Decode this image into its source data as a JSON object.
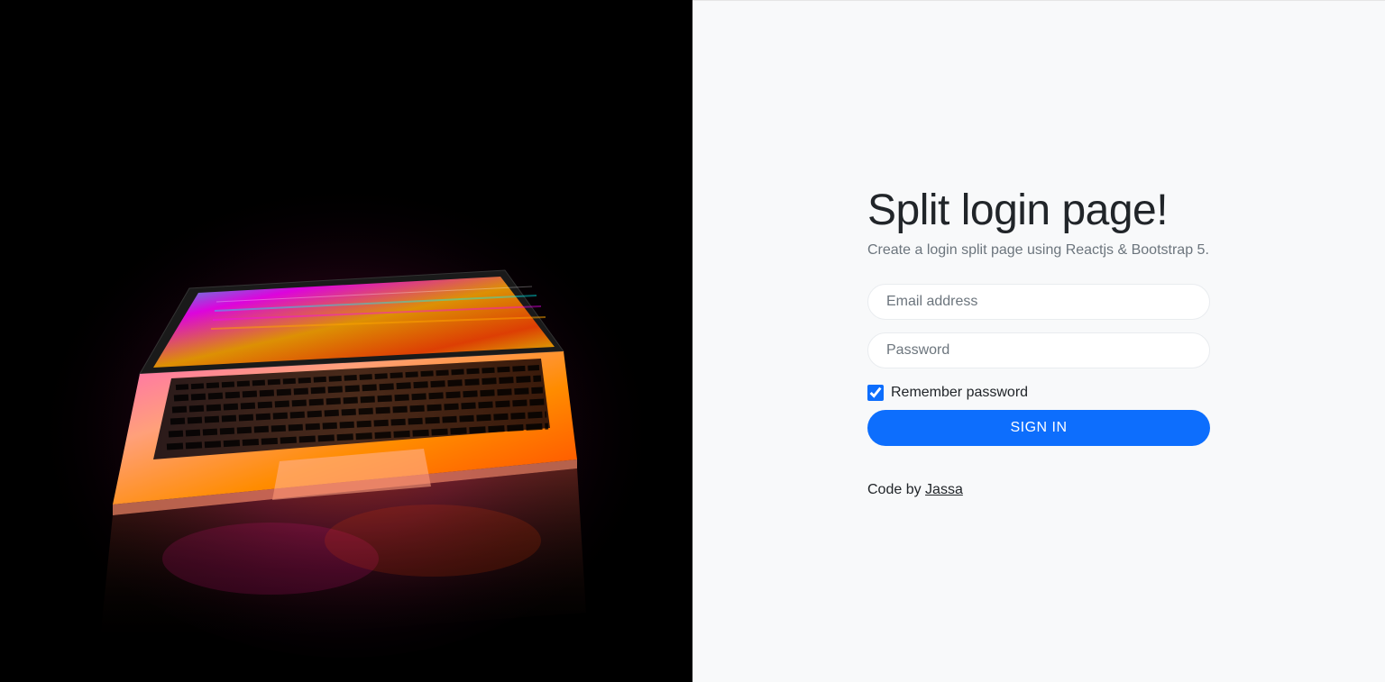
{
  "login": {
    "title": "Split login page!",
    "subtitle": "Create a login split page using Reactjs & Bootstrap 5.",
    "email_placeholder": "Email address",
    "password_placeholder": "Password",
    "remember_label": "Remember password",
    "remember_checked": true,
    "signin_button": "Sign in",
    "credit_prefix": "Code by ",
    "credit_author": "Jassa"
  }
}
